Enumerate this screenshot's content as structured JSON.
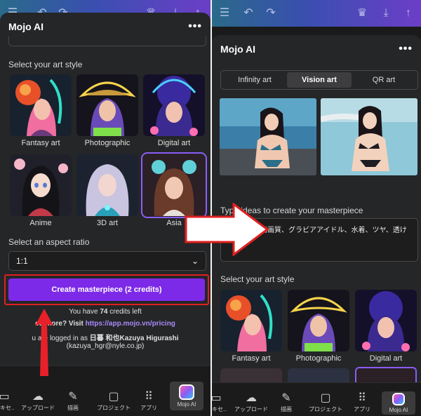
{
  "app": {
    "title": "Mojo AI",
    "more_label": "•••"
  },
  "left": {
    "style_section": "Select your art style",
    "styles": [
      {
        "label": "Fantasy art"
      },
      {
        "label": "Photographic"
      },
      {
        "label": "Digital art"
      },
      {
        "label": "Anime"
      },
      {
        "label": "3D art"
      },
      {
        "label": "Asia"
      }
    ],
    "aspect_section": "Select an aspect ratio",
    "aspect_value": "1:1",
    "create_button": "Create masterpiece (2 credits)",
    "credits_prefix": "You have ",
    "credits_count": "74",
    "credits_suffix": " credits left",
    "need_more": "ed more? Visit ",
    "pricing_link": "https://app.mojo.vn/pricing",
    "logged_in_prefix": "u are logged in as ",
    "user_name": "日暮 和也Kazuya Higurashi",
    "user_email": "(kazuya_hgr@nyle.co.jp)"
  },
  "right": {
    "tabs": [
      {
        "label": "Infinity art"
      },
      {
        "label": "Vision art"
      },
      {
        "label": "QR art"
      }
    ],
    "prompt_label": "Type ideas to create your masterpiece",
    "prompt_value": "高画質、グラビアアイドル、水着、ツヤ、透け感",
    "style_section": "Select your art style",
    "styles": [
      {
        "label": "Fantasy art"
      },
      {
        "label": "Photographic"
      },
      {
        "label": "Digital art"
      }
    ]
  },
  "nav_left": [
    {
      "label": "ドキセ..",
      "icon": "document-icon"
    },
    {
      "label": "アップロード",
      "icon": "upload-cloud-icon"
    },
    {
      "label": "描画",
      "icon": "pen-icon"
    },
    {
      "label": "プロジェクト",
      "icon": "folder-icon"
    },
    {
      "label": "アプリ",
      "icon": "grid-icon"
    },
    {
      "label": "Mojo AI",
      "icon": "mojo-logo-icon"
    }
  ],
  "nav_right": [
    {
      "label": "ドキセ..",
      "icon": "document-icon"
    },
    {
      "label": "アップロード",
      "icon": "upload-cloud-icon"
    },
    {
      "label": "描画",
      "icon": "pen-icon"
    },
    {
      "label": "プロジェクト",
      "icon": "folder-icon"
    },
    {
      "label": "アプリ",
      "icon": "grid-icon"
    },
    {
      "label": "Mojo AI",
      "icon": "mojo-logo-icon"
    }
  ],
  "colors": {
    "accent": "#7d2ae8",
    "highlight": "#e02020",
    "link": "#a78bfa",
    "panel": "#252627"
  }
}
